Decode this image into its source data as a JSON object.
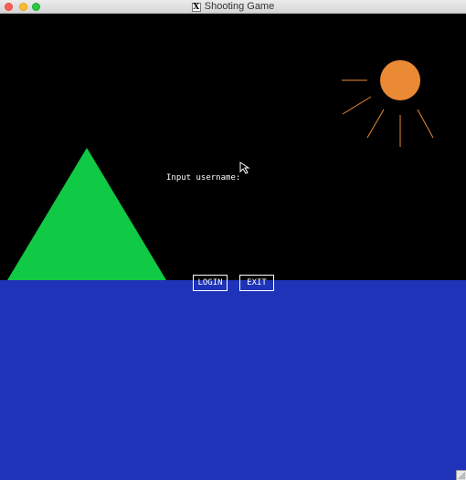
{
  "window": {
    "title": "Shooting Game",
    "title_icon_glyph": "X"
  },
  "scene": {
    "sky_color": "#000000",
    "sea_color": "#1e33b8",
    "mountain_color": "#10c944",
    "sun_color": "#ea8a35"
  },
  "login": {
    "prompt": "Input username:",
    "login_label": "LOGIN",
    "exit_label": "EXIT"
  },
  "icons": {
    "close": "close-icon",
    "minimize": "minimize-icon",
    "maximize": "maximize-icon",
    "app": "x11-icon",
    "cursor": "mouse-cursor-icon",
    "resize": "resize-grip-icon"
  }
}
